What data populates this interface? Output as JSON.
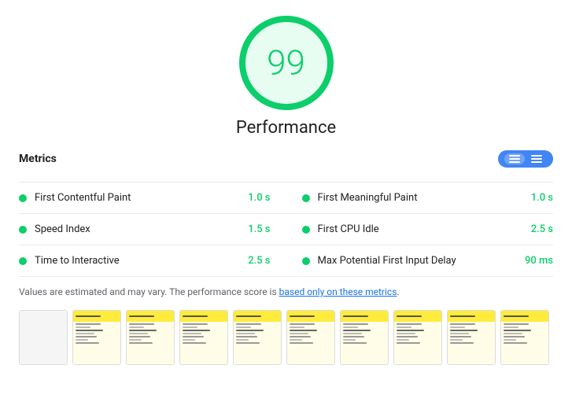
{
  "score": {
    "value": "99",
    "label": "Performance"
  },
  "metrics_section": {
    "title": "Metrics",
    "toggle": {
      "list_label": "List view",
      "grid_label": "Grid view"
    },
    "items": [
      {
        "name": "First Contentful Paint",
        "value": "1.0 s",
        "color": "#0cce6b"
      },
      {
        "name": "First Meaningful Paint",
        "value": "1.0 s",
        "color": "#0cce6b"
      },
      {
        "name": "Speed Index",
        "value": "1.5 s",
        "color": "#0cce6b"
      },
      {
        "name": "First CPU Idle",
        "value": "2.5 s",
        "color": "#0cce6b"
      },
      {
        "name": "Time to Interactive",
        "value": "2.5 s",
        "color": "#0cce6b"
      },
      {
        "name": "Max Potential First Input Delay",
        "value": "90 ms",
        "color": "#0cce6b"
      }
    ]
  },
  "disclaimer": {
    "text_before": "Values are estimated and may vary. The performance score is ",
    "link_text": "based only on these metrics",
    "text_after": "."
  },
  "filmstrip": {
    "frames": [
      {
        "id": 1,
        "blank": true
      },
      {
        "id": 2,
        "blank": false
      },
      {
        "id": 3,
        "blank": false
      },
      {
        "id": 4,
        "blank": false
      },
      {
        "id": 5,
        "blank": false
      },
      {
        "id": 6,
        "blank": false
      },
      {
        "id": 7,
        "blank": false
      },
      {
        "id": 8,
        "blank": false
      },
      {
        "id": 9,
        "blank": false
      },
      {
        "id": 10,
        "blank": false
      }
    ]
  }
}
